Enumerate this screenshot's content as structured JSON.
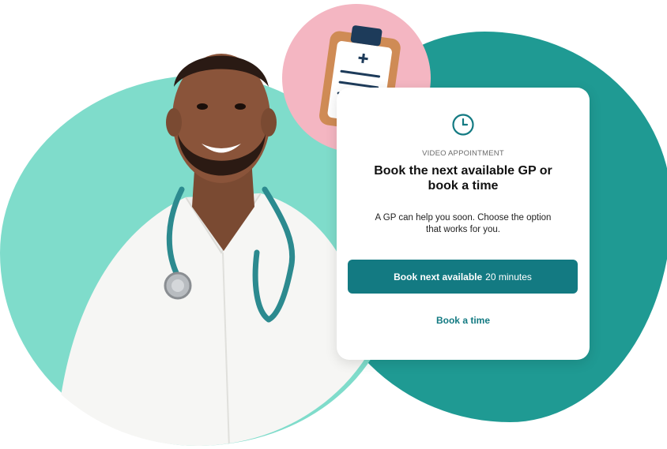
{
  "card": {
    "eyebrow": "VIDEO APPOINTMENT",
    "title": "Book the next available GP or book a time",
    "body": "A GP can help you soon. Choose the option that works for you.",
    "primary_button": {
      "label_strong": "Book next available",
      "label_rest": "20 minutes"
    },
    "secondary_button": "Book a time"
  },
  "icons": [
    "clock-icon",
    "clipboard-icon",
    "stethoscope-icon"
  ],
  "colors": {
    "primary": "#137a82",
    "blob_dark": "#1f9a93",
    "blob_light": "#7fdccb",
    "clipboard_bg": "#f4b6c2"
  }
}
